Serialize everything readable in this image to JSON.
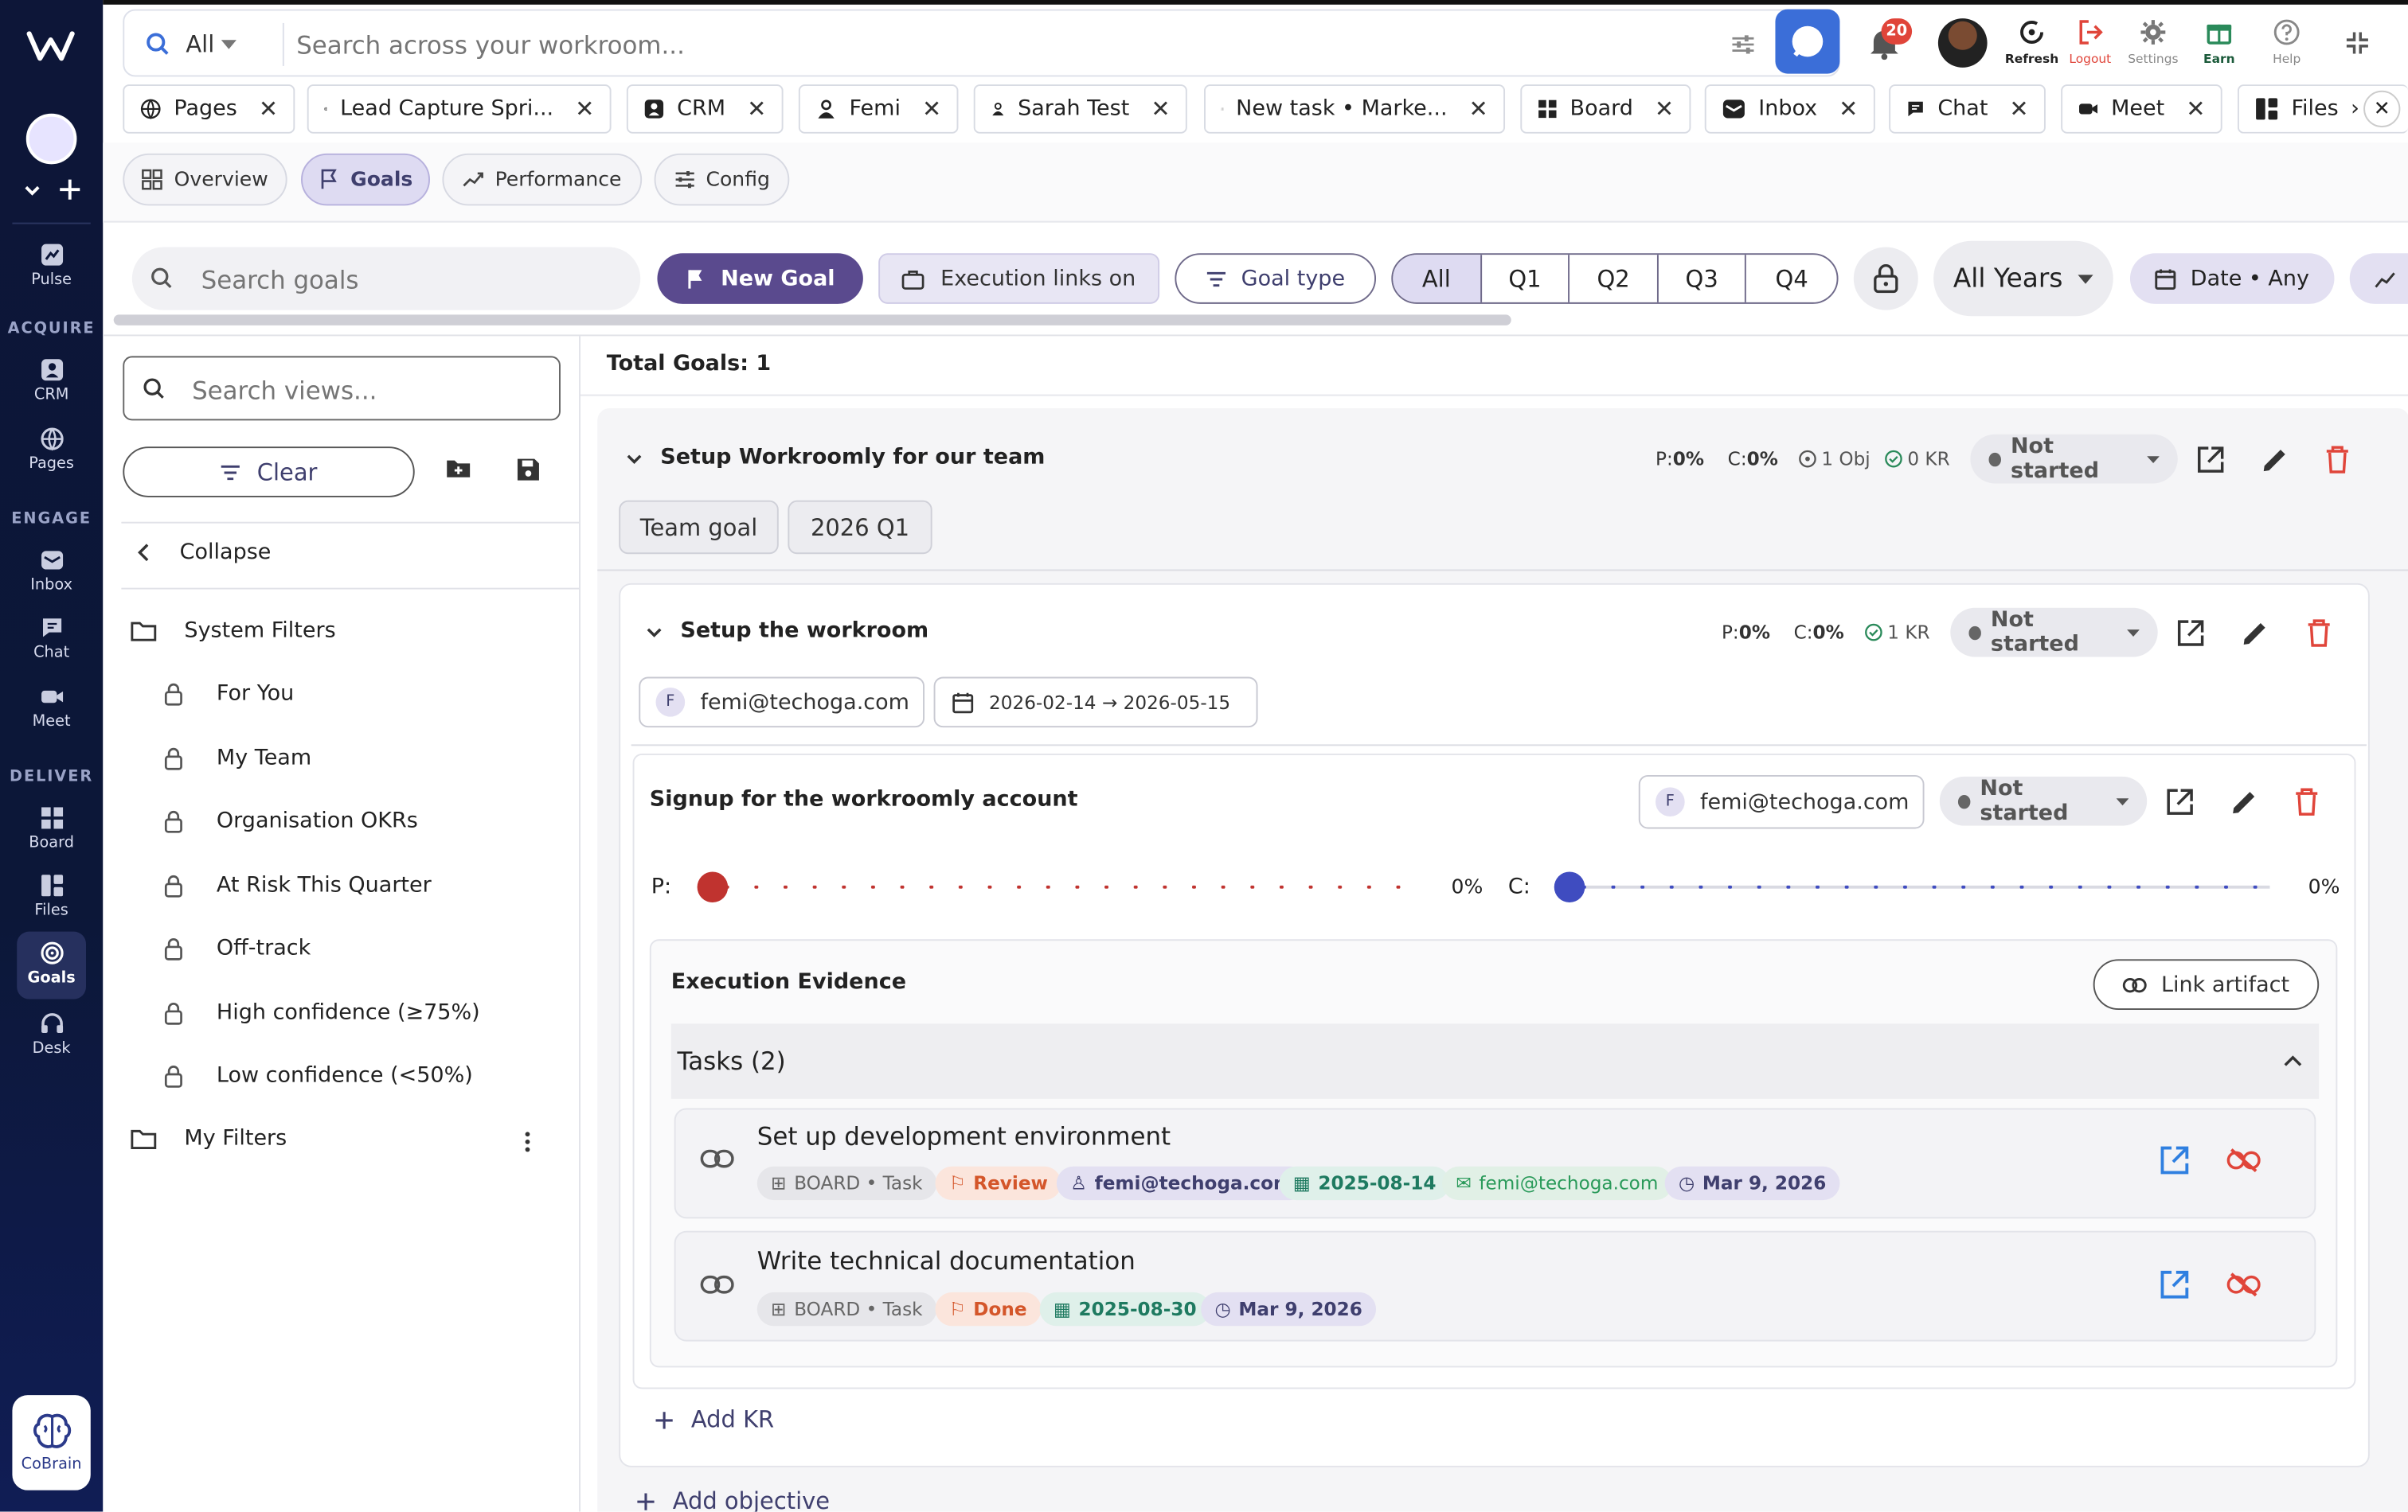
{
  "rail": {
    "items": [
      {
        "label": "Pulse"
      },
      {
        "label": "CRM"
      },
      {
        "label": "Pages"
      },
      {
        "label": "Inbox"
      },
      {
        "label": "Chat"
      },
      {
        "label": "Meet"
      },
      {
        "label": "Board"
      },
      {
        "label": "Files"
      },
      {
        "label": "Goals"
      },
      {
        "label": "Desk"
      }
    ],
    "sections": {
      "acquire": "ACQUIRE",
      "engage": "ENGAGE",
      "deliver": "DELIVER"
    },
    "cobrain": "CoBrain"
  },
  "topbar": {
    "scope": "All",
    "search_placeholder": "Search across your workroom...",
    "notif_count": "20",
    "actions": {
      "refresh": "Refresh",
      "logout": "Logout",
      "settings": "Settings",
      "earn": "Earn",
      "help": "Help"
    }
  },
  "tabs": [
    "Pages",
    "Lead Capture Spri...",
    "CRM",
    "Femi",
    "Sarah Test",
    "New task • Marke...",
    "Board",
    "Inbox",
    "Chat",
    "Meet",
    "Files"
  ],
  "subnav": {
    "overview": "Overview",
    "goals": "Goals",
    "performance": "Performance",
    "config": "Config"
  },
  "toolbar": {
    "search_placeholder": "Search goals",
    "new_goal": "New Goal",
    "exec_links": "Execution links on",
    "goal_type": "Goal type",
    "quarters": [
      "All",
      "Q1",
      "Q2",
      "Q3",
      "Q4"
    ],
    "years": "All Years",
    "date": "Date • Any"
  },
  "sidebar": {
    "search_placeholder": "Search views...",
    "clear": "Clear",
    "collapse": "Collapse",
    "system_filters": "System Filters",
    "filters": [
      "For You",
      "My Team",
      "Organisation OKRs",
      "At Risk This Quarter",
      "Off-track",
      "High confidence (≥75%)",
      "Low confidence (<50%)"
    ],
    "my_filters": "My Filters"
  },
  "main": {
    "total": "Total Goals: 1",
    "goal": {
      "title": "Setup Workroomly for our team",
      "p": "P:",
      "p_val": "0%",
      "c": "C:",
      "c_val": "0%",
      "obj": "1 Obj",
      "kr": "0 KR",
      "status": "Not started",
      "tags": [
        "Team goal",
        "2026 Q1"
      ]
    },
    "objective": {
      "title": "Setup the workroom",
      "p": "P:",
      "p_val": "0%",
      "c": "C:",
      "c_val": "0%",
      "kr": "1 KR",
      "status": "Not started",
      "owner_initial": "F",
      "owner": "femi@techoga.com",
      "dates": "2026-02-14 → 2026-05-15"
    },
    "kr": {
      "title": "Signup for the workroomly account",
      "owner_initial": "F",
      "owner": "femi@techoga.com",
      "status": "Not started",
      "p_label": "P:",
      "p_val": "0%",
      "p_progress": 0,
      "c_label": "C:",
      "c_val": "0%",
      "c_progress": 0
    },
    "evidence": {
      "title": "Execution Evidence",
      "link_artifact": "Link artifact",
      "tasks_header": "Tasks (2)",
      "tasks": [
        {
          "title": "Set up development environment",
          "source": "BOARD • Task",
          "status": "Review",
          "assignee": "femi@techoga.com",
          "due": "2025-08-14",
          "reporter": "femi@techoga.com",
          "updated": "Mar 9, 2026"
        },
        {
          "title": "Write technical documentation",
          "source": "BOARD • Task",
          "status": "Done",
          "due": "2025-08-30",
          "updated": "Mar 9, 2026"
        }
      ]
    },
    "add_kr": "Add KR",
    "add_objective": "Add objective"
  },
  "colors": {
    "accent": "#5a4a8e",
    "rail": "#0d1638",
    "danger": "#e0453a",
    "progress_p": "#c0332f",
    "progress_c": "#3f4cc0"
  }
}
